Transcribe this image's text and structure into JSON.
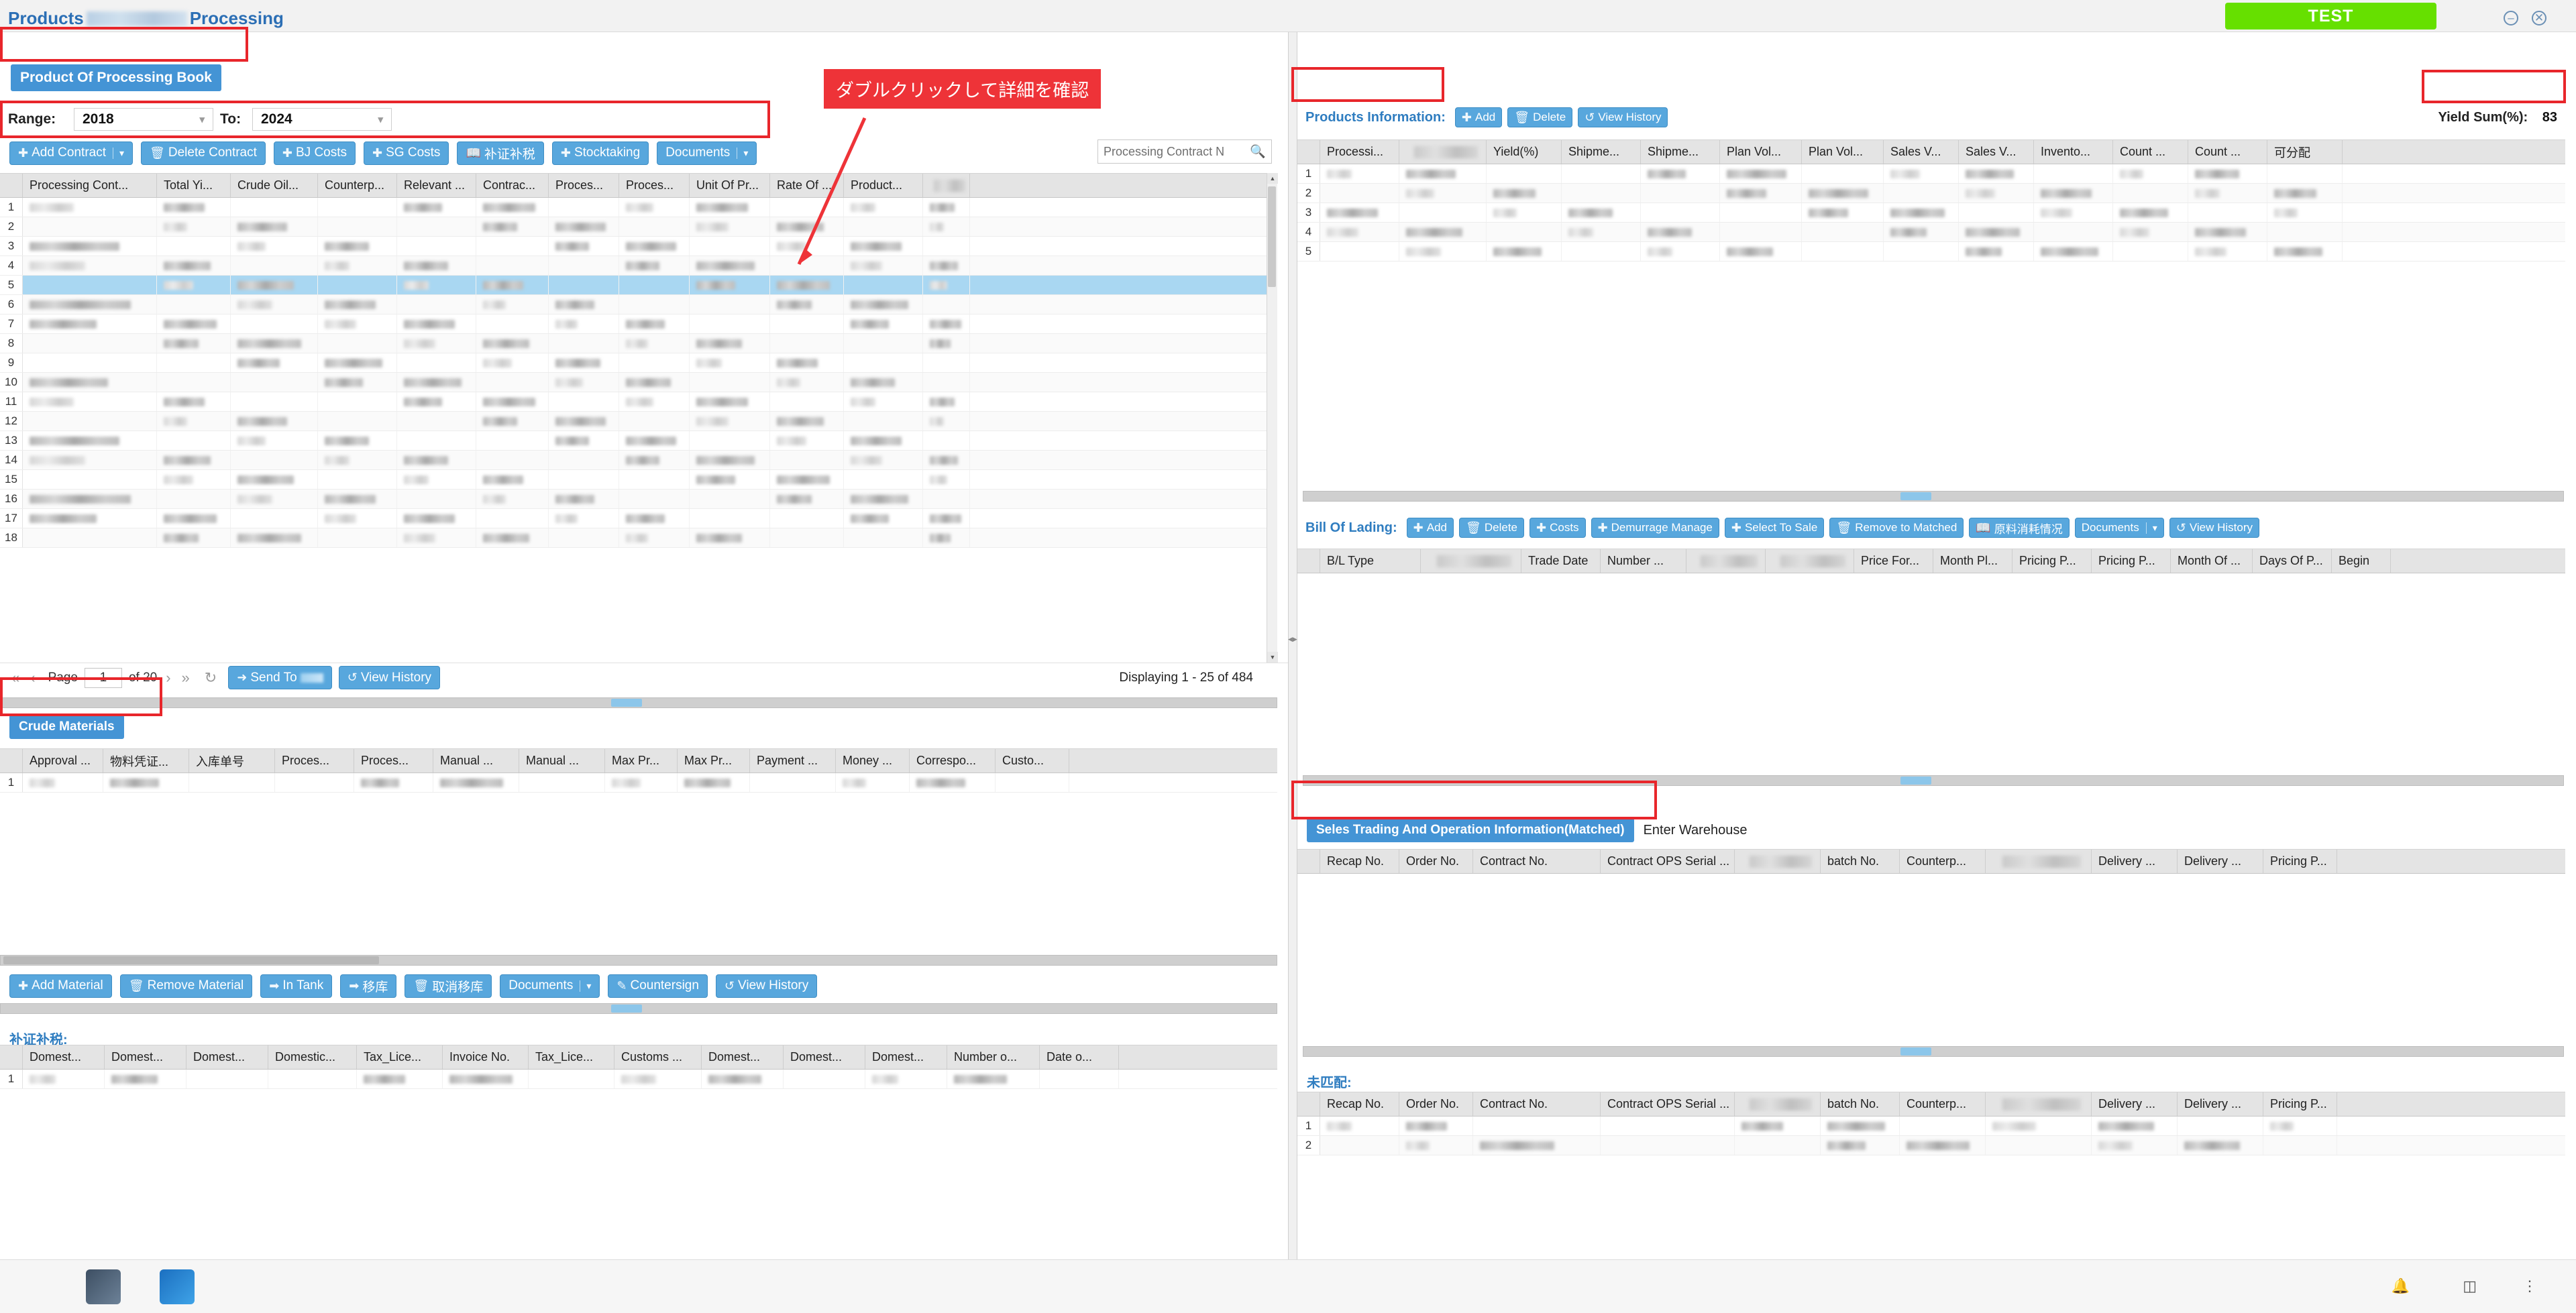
{
  "window": {
    "test_label": "TEST",
    "minimize_icon": "minimize-icon",
    "close_icon": "close-icon"
  },
  "page": {
    "title_prefix": "Products",
    "title_suffix": "Processing",
    "tab_label": "Product Of Processing Book"
  },
  "filters": {
    "range_label": "Range:",
    "range_from": "2018",
    "to_label": "To:",
    "range_to": "2024"
  },
  "annotation": {
    "callout_text": "ダブルクリックして詳細を確認"
  },
  "main_toolbar": [
    {
      "label": "Add Contract",
      "icon": "plus-icon",
      "caret": true
    },
    {
      "label": "Delete Contract",
      "icon": "trash-icon",
      "caret": false
    },
    {
      "label": "BJ Costs",
      "icon": "plus-icon",
      "caret": false
    },
    {
      "label": "SG Costs",
      "icon": "plus-icon",
      "caret": false
    },
    {
      "label": "补证补税",
      "icon": "book-icon",
      "caret": false
    },
    {
      "label": "Stocktaking",
      "icon": "plus-icon",
      "caret": false
    },
    {
      "label": "Documents",
      "icon": "",
      "caret": true
    }
  ],
  "search": {
    "placeholder": "Processing Contract N",
    "icon": "search-icon"
  },
  "contract_grid": {
    "columns": [
      "Processing Cont...",
      "Total Yi...",
      "Crude Oil...",
      "Counterp...",
      "Relevant ...",
      "Contrac...",
      "Proces...",
      "Proces...",
      "Unit Of Pr...",
      "Rate Of ...",
      "Product...",
      ""
    ],
    "row_numbers": [
      "1",
      "2",
      "3",
      "4",
      "5",
      "6",
      "7",
      "8",
      "9",
      "10",
      "11",
      "12",
      "13",
      "14",
      "15",
      "16",
      "17",
      "18"
    ],
    "selected_row": 5
  },
  "pager": {
    "first_icon": "first-page-icon",
    "prev_icon": "prev-page-icon",
    "page_label": "Page",
    "page_value": "1",
    "of_label": "of 20",
    "next_icon": "next-page-icon",
    "last_icon": "last-page-icon",
    "refresh_icon": "refresh-icon",
    "send_to_label": "Send To",
    "view_history_label": "View History",
    "displaying": "Displaying 1 - 25 of 484"
  },
  "crude_materials": {
    "tab_label": "Crude Materials",
    "columns": [
      "Approval ...",
      "物料凭证...",
      "入库单号",
      "Proces...",
      "Proces...",
      "Manual ...",
      "Manual ...",
      "Max Pr...",
      "Max Pr...",
      "Payment ...",
      "Money ...",
      "Correspo...",
      "Custo..."
    ],
    "row_numbers": [
      "1"
    ],
    "toolbar": [
      {
        "label": "Add Material",
        "icon": "plus-icon",
        "caret": false
      },
      {
        "label": "Remove Material",
        "icon": "trash-icon",
        "caret": false
      },
      {
        "label": "In Tank",
        "icon": "arrow-right-icon",
        "caret": false
      },
      {
        "label": "移库",
        "icon": "arrow-right-icon",
        "caret": false
      },
      {
        "label": "取消移库",
        "icon": "trash-icon",
        "caret": false
      },
      {
        "label": "Documents",
        "icon": "",
        "caret": true
      },
      {
        "label": "Countersign",
        "icon": "pen-icon",
        "caret": false
      },
      {
        "label": "View History",
        "icon": "history-icon",
        "caret": false
      }
    ]
  },
  "tax_section": {
    "title": "补证补税:",
    "columns": [
      "Domest...",
      "Domest...",
      "Domest...",
      "Domestic...",
      "Tax_Lice...",
      "Invoice No.",
      "Tax_Lice...",
      "Customs ...",
      "Domest...",
      "Domest...",
      "Domest...",
      "Number o...",
      "Date o..."
    ],
    "row_numbers": [
      "1"
    ]
  },
  "products_information": {
    "title": "Products Information:",
    "toolbar": [
      {
        "label": "Add",
        "icon": "plus-icon"
      },
      {
        "label": "Delete",
        "icon": "trash-icon"
      },
      {
        "label": "View History",
        "icon": "history-icon"
      }
    ],
    "yield_sum_label": "Yield Sum(%):",
    "yield_sum_value": "83",
    "columns": [
      "Processi...",
      "",
      "Yield(%)",
      "Shipme...",
      "Shipme...",
      "Plan Vol...",
      "Plan Vol...",
      "Sales V...",
      "Sales V...",
      "Invento...",
      "Count ...",
      "Count ...",
      "可分配"
    ],
    "row_numbers": [
      "1",
      "2",
      "3",
      "4",
      "5"
    ]
  },
  "bill_of_lading": {
    "title": "Bill Of Lading:",
    "toolbar": [
      {
        "label": "Add",
        "icon": "plus-icon",
        "caret": false
      },
      {
        "label": "Delete",
        "icon": "trash-icon",
        "caret": false
      },
      {
        "label": "Costs",
        "icon": "plus-icon",
        "caret": false
      },
      {
        "label": "Demurrage Manage",
        "icon": "plus-icon",
        "caret": false
      },
      {
        "label": "Select To Sale",
        "icon": "plus-icon",
        "caret": false
      },
      {
        "label": "Remove to Matched",
        "icon": "trash-icon",
        "caret": false
      },
      {
        "label": "原料消耗情况",
        "icon": "book-icon",
        "caret": false
      },
      {
        "label": "Documents",
        "icon": "",
        "caret": true
      },
      {
        "label": "View History",
        "icon": "history-icon",
        "caret": false
      }
    ],
    "columns": [
      "B/L Type",
      "",
      "Trade Date",
      "Number ...",
      "",
      "",
      "Price For...",
      "Month Pl...",
      "Pricing P...",
      "Pricing P...",
      "Month Of ...",
      "Days Of P...",
      "Begin"
    ]
  },
  "sales_trading": {
    "tab_label": "Seles Trading And Operation Information(Matched)",
    "tab2_label": "Enter Warehouse",
    "columns": [
      "Recap No.",
      "Order No.",
      "Contract No.",
      "Contract OPS Serial ...",
      "",
      "batch No.",
      "Counterp...",
      "",
      "Delivery ...",
      "Delivery ...",
      "Pricing P..."
    ]
  },
  "unmatched": {
    "title": "未匹配:",
    "columns": [
      "Recap No.",
      "Order No.",
      "Contract No.",
      "Contract OPS Serial ...",
      "",
      "batch No.",
      "Counterp...",
      "",
      "Delivery ...",
      "Delivery ...",
      "Pricing P..."
    ],
    "row_numbers": [
      "1",
      "2"
    ]
  },
  "taskbar": {
    "notification_icon": "bell-icon",
    "panel_icon": "panel-icon",
    "more_icon": "ellipsis-icon"
  },
  "colors": {
    "accent_blue": "#58a7dd",
    "link_blue": "#2f7dc0",
    "annotation_red": "#e8262b",
    "test_green": "#66e000",
    "selected_row": "#a9d7f2"
  }
}
